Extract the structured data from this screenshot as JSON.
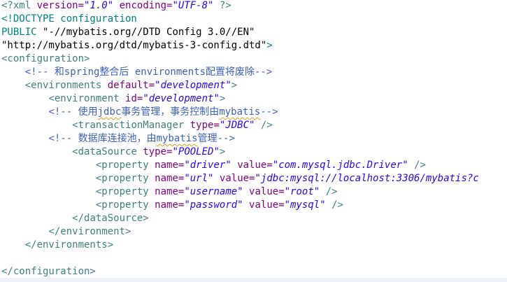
{
  "colors": {
    "tag": "#3f7f7f",
    "attribute": "#7f007f",
    "value": "#2a00ff",
    "comment": "#3f5fbf",
    "doctype": "#008080",
    "text": "#000000",
    "squiggle": "#d4a017"
  },
  "editor": {
    "lines": [
      [
        [
          "tag",
          "<?xml "
        ],
        [
          "attr",
          "version="
        ],
        [
          "val",
          "\"1.0\""
        ],
        [
          "txt",
          " "
        ],
        [
          "attr",
          "encoding="
        ],
        [
          "val",
          "\"UTF-8\""
        ],
        [
          "tag",
          " ?>"
        ]
      ],
      [
        [
          "dt",
          "<!DOCTYPE configuration"
        ]
      ],
      [
        [
          "dt",
          "PUBLIC "
        ],
        [
          "txt",
          "\"-//mybatis.org//DTD Config 3.0//EN\""
        ]
      ],
      [
        [
          "txt",
          "\"http://mybatis.org/dtd/mybatis-3-config.dtd\""
        ],
        [
          "dt",
          ">"
        ]
      ],
      [
        [
          "tag",
          "<configuration>"
        ]
      ],
      [
        [
          "ws",
          "    "
        ],
        [
          "cmt",
          "<!-- 和spring整合后 environments配置将废除-->"
        ]
      ],
      [
        [
          "ws",
          "    "
        ],
        [
          "tag",
          "<environments "
        ],
        [
          "attr",
          "default="
        ],
        [
          "val",
          "\"development\""
        ],
        [
          "tag",
          ">"
        ]
      ],
      [
        [
          "ws",
          "        "
        ],
        [
          "tag",
          "<environment "
        ],
        [
          "attr",
          "id="
        ],
        [
          "val",
          "\"development\""
        ],
        [
          "tag",
          ">"
        ]
      ],
      [
        [
          "ws",
          "        "
        ],
        [
          "cmt",
          "<!-- 使用"
        ],
        [
          "cmtsq",
          "jdbc"
        ],
        [
          "cmt",
          "事务管理，事务控制由"
        ],
        [
          "cmtsq",
          "mybatis"
        ],
        [
          "cmt",
          "-->"
        ]
      ],
      [
        [
          "ws",
          "            "
        ],
        [
          "tag",
          "<transactionManager "
        ],
        [
          "attr",
          "type="
        ],
        [
          "val",
          "\"JDBC\""
        ],
        [
          "tag",
          " />"
        ]
      ],
      [
        [
          "ws",
          "        "
        ],
        [
          "cmt",
          "<!-- 数据库连接池，由"
        ],
        [
          "cmtsq",
          "mybatis"
        ],
        [
          "cmt",
          "管理-->"
        ]
      ],
      [
        [
          "ws",
          "            "
        ],
        [
          "tag",
          "<dataSource "
        ],
        [
          "attr",
          "type="
        ],
        [
          "val",
          "\"POOLED\""
        ],
        [
          "tag",
          ">"
        ]
      ],
      [
        [
          "ws",
          "                "
        ],
        [
          "tag",
          "<property "
        ],
        [
          "attr",
          "name="
        ],
        [
          "val",
          "\"driver\""
        ],
        [
          "txt",
          " "
        ],
        [
          "attr",
          "value="
        ],
        [
          "val",
          "\"com.mysql.jdbc.Driver\""
        ],
        [
          "tag",
          " />"
        ]
      ],
      [
        [
          "ws",
          "                "
        ],
        [
          "tag",
          "<property "
        ],
        [
          "attr",
          "name="
        ],
        [
          "val",
          "\"url\""
        ],
        [
          "txt",
          " "
        ],
        [
          "attr",
          "value="
        ],
        [
          "val",
          "\"jdbc:mysql://localhost:3306/mybatis?c"
        ]
      ],
      [
        [
          "ws",
          "                "
        ],
        [
          "tag",
          "<property "
        ],
        [
          "attr",
          "name="
        ],
        [
          "val",
          "\"username\""
        ],
        [
          "txt",
          " "
        ],
        [
          "attr",
          "value="
        ],
        [
          "val",
          "\"root\""
        ],
        [
          "tag",
          " />"
        ]
      ],
      [
        [
          "ws",
          "                "
        ],
        [
          "tag",
          "<property "
        ],
        [
          "attr",
          "name="
        ],
        [
          "val",
          "\"password\""
        ],
        [
          "txt",
          " "
        ],
        [
          "attr",
          "value="
        ],
        [
          "val",
          "\"mysql\""
        ],
        [
          "tag",
          " />"
        ]
      ],
      [
        [
          "ws",
          "            "
        ],
        [
          "tag",
          "</dataSource>"
        ]
      ],
      [
        [
          "ws",
          "        "
        ],
        [
          "tag",
          "</environment>"
        ]
      ],
      [
        [
          "ws",
          "    "
        ],
        [
          "tag",
          "</environments>"
        ]
      ],
      [],
      [
        [
          "tag",
          "</configuration>"
        ]
      ]
    ]
  }
}
